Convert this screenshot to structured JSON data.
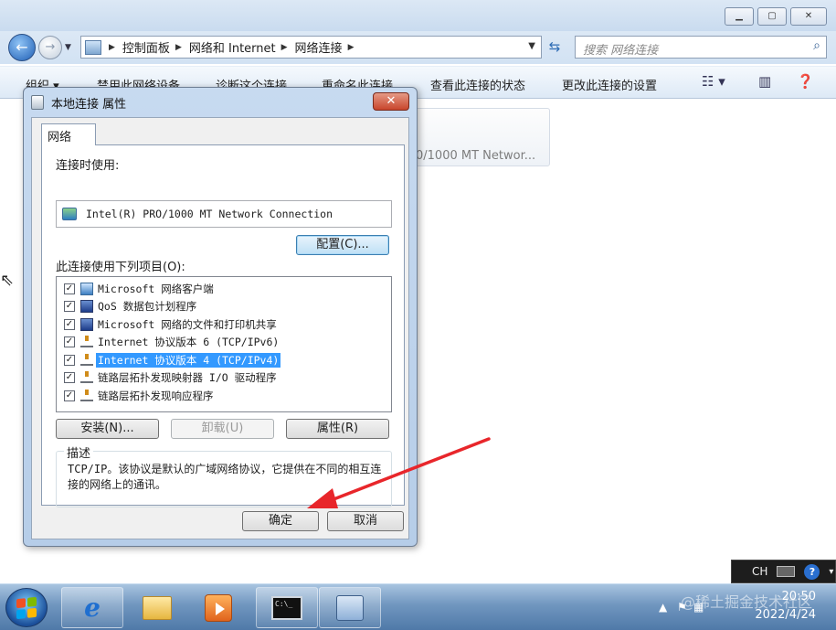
{
  "explorer": {
    "breadcrumb": [
      "控制面板",
      "网络和 Internet",
      "网络连接"
    ],
    "search_placeholder": "搜索 网络连接",
    "commands": [
      "组织 ▾",
      "禁用此网络设备",
      "诊断这个连接",
      "重命名此连接",
      "查看此连接的状态",
      "更改此连接的设置"
    ],
    "connection_tile_text": "0/1000 MT Networ..."
  },
  "dialog": {
    "title": "本地连接 属性",
    "tab": "网络",
    "connect_using_label": "连接时使用:",
    "adapter": "Intel(R) PRO/1000 MT Network Connection",
    "configure_button": "配置(C)...",
    "items_label": "此连接使用下列项目(O):",
    "items": [
      {
        "label": "Microsoft 网络客户端",
        "checked": true,
        "icon": "network-client-icon"
      },
      {
        "label": "QoS 数据包计划程序",
        "checked": true,
        "icon": "computer-icon"
      },
      {
        "label": "Microsoft 网络的文件和打印机共享",
        "checked": true,
        "icon": "computer-icon"
      },
      {
        "label": "Internet 协议版本 6 (TCP/IPv6)",
        "checked": true,
        "icon": "protocol-icon"
      },
      {
        "label": "Internet 协议版本 4 (TCP/IPv4)",
        "checked": true,
        "icon": "protocol-icon",
        "selected": true
      },
      {
        "label": "链路层拓扑发现映射器 I/O 驱动程序",
        "checked": true,
        "icon": "protocol-icon"
      },
      {
        "label": "链路层拓扑发现响应程序",
        "checked": true,
        "icon": "protocol-icon"
      }
    ],
    "install_button": "安装(N)...",
    "uninstall_button": "卸载(U)",
    "properties_button": "属性(R)",
    "description_title": "描述",
    "description_text": "TCP/IP。该协议是默认的广域网络协议，它提供在不同的相互连接的网络上的通讯。",
    "ok_button": "确定",
    "cancel_button": "取消"
  },
  "taskbar": {
    "language": "CH",
    "time": "20:50",
    "date": "2022/4/24",
    "watermark": "@稀土掘金技术社区"
  },
  "colors": {
    "selection": "#3399ff",
    "arrow": "#e8262b"
  }
}
